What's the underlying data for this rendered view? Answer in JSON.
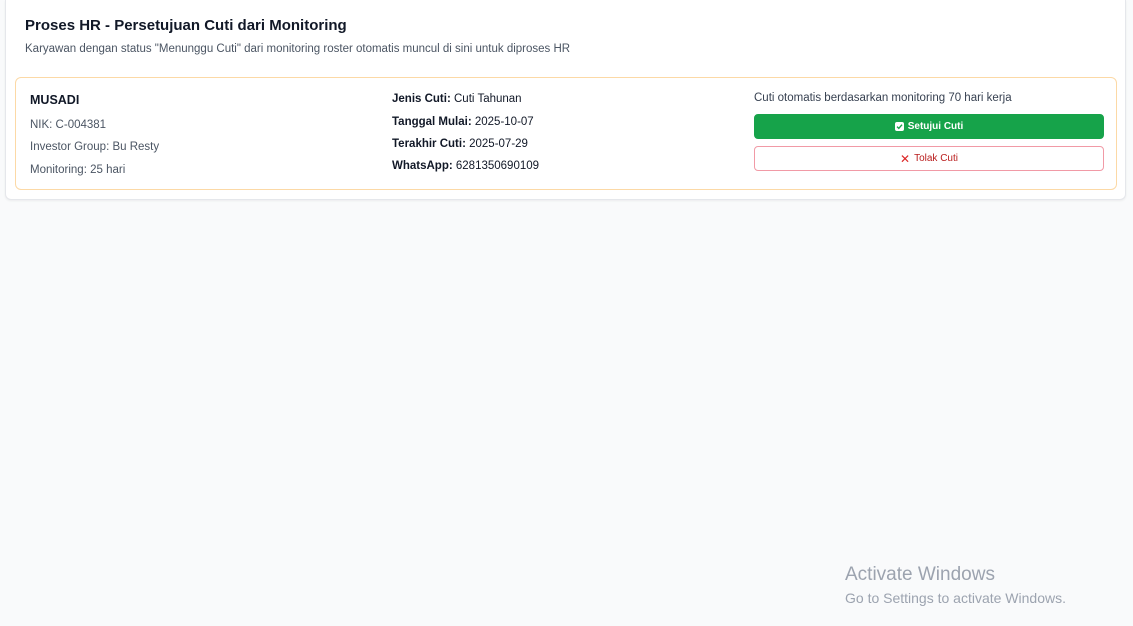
{
  "header": {
    "title": "Proses HR - Persetujuan Cuti dari Monitoring",
    "subtitle": "Karyawan dengan status \"Menunggu Cuti\" dari monitoring roster otomatis muncul di sini untuk diproses HR"
  },
  "request": {
    "name": "MUSADI",
    "nik": "NIK: C-004381",
    "investor_group": "Investor Group: Bu Resty",
    "monitoring": "Monitoring: 25 hari",
    "leave_type_label": "Jenis Cuti:",
    "leave_type_value": "Cuti Tahunan",
    "start_label": "Tanggal Mulai:",
    "start_value": "2025-10-07",
    "last_label": "Terakhir Cuti:",
    "last_value": "2025-07-29",
    "whatsapp_label": "WhatsApp:",
    "whatsapp_value": "6281350690109",
    "note": "Cuti otomatis berdasarkan monitoring 70 hari kerja",
    "approve_label": "Setujui Cuti",
    "reject_label": "Tolak Cuti"
  },
  "watermark": {
    "title": "Activate Windows",
    "subtitle": "Go to Settings to activate Windows."
  },
  "colors": {
    "approve": "#16a34a",
    "reject_border": "#f19aa6",
    "reject_text": "#b91c1c",
    "card_border": "#fcd9a6"
  },
  "icons": {
    "approve": "check-box-icon",
    "reject": "x-icon"
  }
}
